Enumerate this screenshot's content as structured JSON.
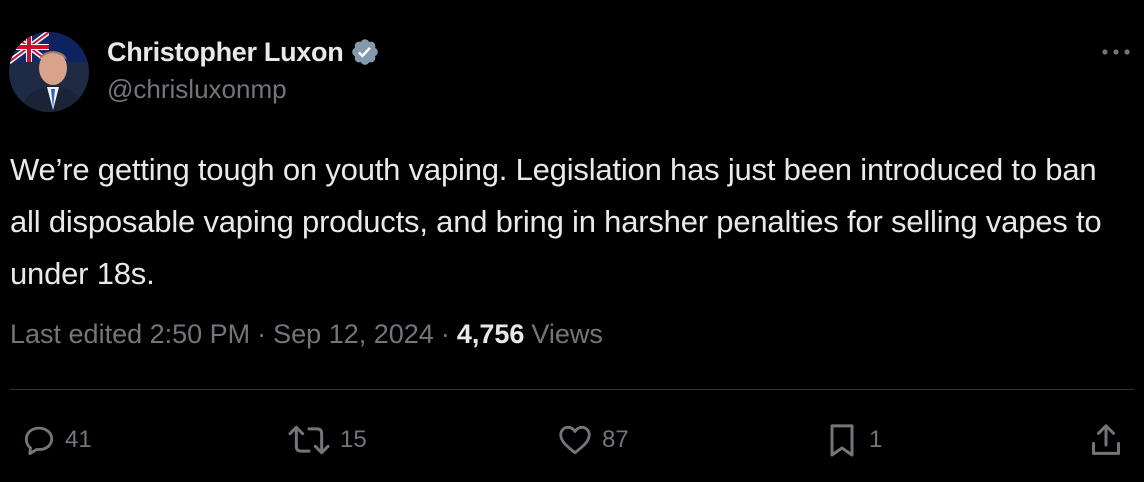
{
  "author": {
    "name": "Christopher Luxon",
    "handle": "@chrisluxonmp",
    "verified": true
  },
  "tweet": {
    "text": "We’re getting tough on youth vaping. Legislation has just been introduced to ban all disposable vaping products, and bring in harsher penalties for selling vapes to under 18s."
  },
  "meta": {
    "edited_label": "Last edited 2:50 PM",
    "separator": "·",
    "date": "Sep 12, 2024",
    "views_count": "4,756",
    "views_label": "Views"
  },
  "actions": {
    "replies": "41",
    "reposts": "15",
    "likes": "87",
    "bookmarks": "1"
  },
  "icons": {
    "more": "more-horizontal-icon",
    "verified": "verified-badge-icon",
    "reply": "reply-icon",
    "repost": "repost-icon",
    "like": "heart-icon",
    "bookmark": "bookmark-icon",
    "share": "share-icon"
  },
  "colors": {
    "background": "#000000",
    "text_primary": "#e7e9ea",
    "text_secondary": "#71767b",
    "divider": "#2f3336",
    "verified_badge": "#829aab"
  }
}
